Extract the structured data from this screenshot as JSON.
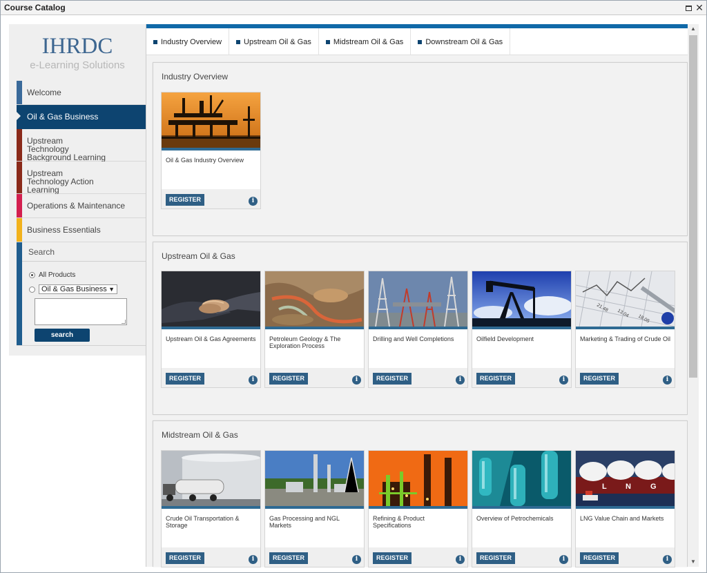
{
  "window": {
    "title": "Course Catalog"
  },
  "logo": {
    "brand": "IHRDC",
    "tagline": "e-Learning Solutions"
  },
  "nav": [
    {
      "label": "Welcome",
      "color": "#3a6a9a",
      "active": false
    },
    {
      "label": "Oil & Gas Business",
      "color": "#0d4470",
      "active": true
    },
    {
      "label": "Upstream Technology Background Learning",
      "color": "#8a2a1a",
      "active": false
    },
    {
      "label": "Upstream Technology Action Learning",
      "color": "#8a2a1a",
      "active": false
    },
    {
      "label": "Operations & Maintenance",
      "color": "#d31f4f",
      "active": false
    },
    {
      "label": "Business Essentials",
      "color": "#f2b21d",
      "active": false
    }
  ],
  "search": {
    "heading": "Search",
    "option_all": "All Products",
    "option_filter": "Oil & Gas Business",
    "button": "search"
  },
  "tabs": [
    "Industry Overview",
    "Upstream Oil & Gas",
    "Midstream Oil & Gas",
    "Downstream Oil & Gas"
  ],
  "sections": [
    {
      "title": "Industry Overview",
      "courses": [
        {
          "name": "Oil & Gas Industry Overview",
          "image": "offshore-platform-sunset"
        }
      ]
    },
    {
      "title": "Upstream Oil & Gas",
      "courses": [
        {
          "name": "Upstream Oil & Gas Agreements",
          "image": "handshake"
        },
        {
          "name": "Petroleum Geology & The Exploration Process",
          "image": "canyon-aerial"
        },
        {
          "name": "Drilling and Well Completions",
          "image": "drilling-rig"
        },
        {
          "name": "Oilfield Development",
          "image": "pumpjack"
        },
        {
          "name": "Marketing & Trading of Crude Oil",
          "image": "financial-chart-pen"
        }
      ]
    },
    {
      "title": "Midstream Oil & Gas",
      "courses": [
        {
          "name": "Crude Oil Transportation & Storage",
          "image": "tanker-truck"
        },
        {
          "name": "Gas Processing and NGL Markets",
          "image": "gas-plant"
        },
        {
          "name": "Refining & Product Specifications",
          "image": "refinery-orange"
        },
        {
          "name": "Overview of Petrochemicals",
          "image": "plastic-bottles"
        },
        {
          "name": "LNG Value Chain and Markets",
          "image": "lng-carrier"
        }
      ]
    }
  ],
  "card_labels": {
    "register": "REGISTER",
    "info": "i"
  }
}
